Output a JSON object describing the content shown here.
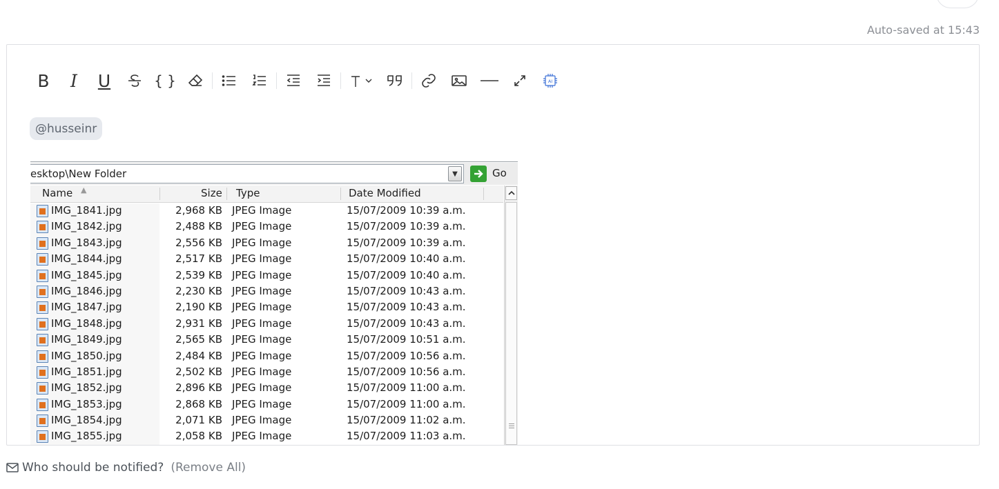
{
  "autosave": {
    "text": "Auto-saved at 15:43"
  },
  "toolbar": {
    "buttons": [
      {
        "id": "bold",
        "label": "B",
        "icon": "bold-icon"
      },
      {
        "id": "italic",
        "label": "I",
        "icon": "italic-icon"
      },
      {
        "id": "underline",
        "label": "U",
        "icon": "underline-icon"
      },
      {
        "id": "strikethrough",
        "icon": "strikethrough-icon"
      },
      {
        "id": "code",
        "label": "{ }",
        "icon": "code-icon"
      },
      {
        "id": "clear-format",
        "icon": "eraser-icon"
      },
      {
        "id": "bullet-list",
        "icon": "bullet-list-icon"
      },
      {
        "id": "numbered-list",
        "icon": "numbered-list-icon"
      },
      {
        "id": "outdent",
        "icon": "outdent-icon"
      },
      {
        "id": "indent",
        "icon": "indent-icon"
      },
      {
        "id": "text-style",
        "icon": "text-style-icon"
      },
      {
        "id": "quote",
        "icon": "quote-icon"
      },
      {
        "id": "link",
        "icon": "link-icon"
      },
      {
        "id": "image",
        "icon": "image-icon"
      },
      {
        "id": "horizontal-rule",
        "icon": "horizontal-rule-icon"
      },
      {
        "id": "fullscreen",
        "icon": "expand-icon"
      },
      {
        "id": "ai",
        "icon": "ai-chip-icon"
      }
    ],
    "ai_color": "#3b6fd6"
  },
  "mention": {
    "text": "@husseinr"
  },
  "explorer": {
    "address": "esktop\\New Folder",
    "go_label": "Go",
    "columns": {
      "name": "Name",
      "size": "Size",
      "type": "Type",
      "date": "Date Modified"
    },
    "files": [
      {
        "name": "IMG_1841.jpg",
        "size": "2,968 KB",
        "type": "JPEG Image",
        "date": "15/07/2009 10:39 a.m."
      },
      {
        "name": "IMG_1842.jpg",
        "size": "2,488 KB",
        "type": "JPEG Image",
        "date": "15/07/2009 10:39 a.m."
      },
      {
        "name": "IMG_1843.jpg",
        "size": "2,556 KB",
        "type": "JPEG Image",
        "date": "15/07/2009 10:39 a.m."
      },
      {
        "name": "IMG_1844.jpg",
        "size": "2,517 KB",
        "type": "JPEG Image",
        "date": "15/07/2009 10:40 a.m."
      },
      {
        "name": "IMG_1845.jpg",
        "size": "2,539 KB",
        "type": "JPEG Image",
        "date": "15/07/2009 10:40 a.m."
      },
      {
        "name": "IMG_1846.jpg",
        "size": "2,230 KB",
        "type": "JPEG Image",
        "date": "15/07/2009 10:43 a.m."
      },
      {
        "name": "IMG_1847.jpg",
        "size": "2,190 KB",
        "type": "JPEG Image",
        "date": "15/07/2009 10:43 a.m."
      },
      {
        "name": "IMG_1848.jpg",
        "size": "2,931 KB",
        "type": "JPEG Image",
        "date": "15/07/2009 10:43 a.m."
      },
      {
        "name": "IMG_1849.jpg",
        "size": "2,565 KB",
        "type": "JPEG Image",
        "date": "15/07/2009 10:51 a.m."
      },
      {
        "name": "IMG_1850.jpg",
        "size": "2,484 KB",
        "type": "JPEG Image",
        "date": "15/07/2009 10:56 a.m."
      },
      {
        "name": "IMG_1851.jpg",
        "size": "2,502 KB",
        "type": "JPEG Image",
        "date": "15/07/2009 10:56 a.m."
      },
      {
        "name": "IMG_1852.jpg",
        "size": "2,896 KB",
        "type": "JPEG Image",
        "date": "15/07/2009 11:00 a.m."
      },
      {
        "name": "IMG_1853.jpg",
        "size": "2,868 KB",
        "type": "JPEG Image",
        "date": "15/07/2009 11:00 a.m."
      },
      {
        "name": "IMG_1854.jpg",
        "size": "2,071 KB",
        "type": "JPEG Image",
        "date": "15/07/2009 11:02 a.m."
      },
      {
        "name": "IMG_1855.jpg",
        "size": "2,058 KB",
        "type": "JPEG Image",
        "date": "15/07/2009 11:03 a.m."
      }
    ]
  },
  "notify": {
    "icon": "envelope-icon",
    "label": "Who should be notified?",
    "remove_all": "(Remove All)"
  }
}
